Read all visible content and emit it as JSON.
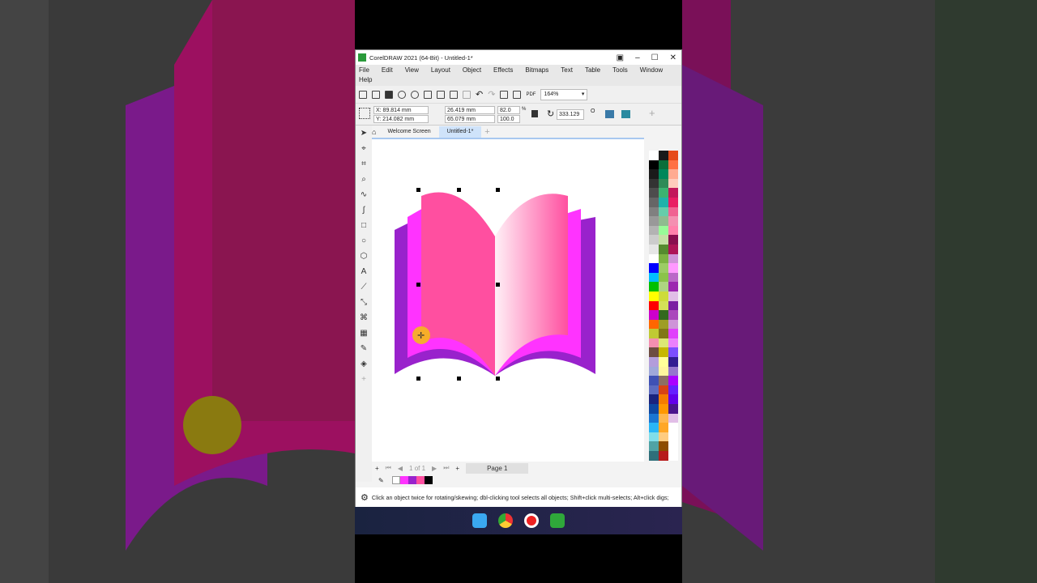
{
  "window": {
    "title": "CorelDRAW 2021 (64-Bit) - Untitled-1*"
  },
  "menu": [
    "File",
    "Edit",
    "View",
    "Layout",
    "Object",
    "Effects",
    "Bitmaps",
    "Text",
    "Table",
    "Tools",
    "Window",
    "Help"
  ],
  "toolbar": {
    "zoom": "164%"
  },
  "props": {
    "x": "X: 89.814 mm",
    "y": "Y: 214.082 mm",
    "w": "26.419 mm",
    "h": "65.079 mm",
    "sx": "82.0",
    "sy": "100.0",
    "pct": "%",
    "angle": "333.129",
    "deg": "O"
  },
  "tabs": [
    "Welcome Screen",
    "Untitled-1*"
  ],
  "pages": {
    "count": "1 of 1",
    "tab": "Page 1"
  },
  "doc_colors": [
    "#ff33ff",
    "#9922cc",
    "#ff4fa0",
    "#000000"
  ],
  "status": "Click an object twice for rotating/skewing; dbl-clicking tool selects all objects; Shift+click multi-selects; Alt+click digs;",
  "palette": [
    "#ffffff",
    "#1a1a1a",
    "#e64a19",
    "#000000",
    "#0b6e3a",
    "#ff7043",
    "#1a1a1a",
    "#00875a",
    "#ffab91",
    "#333333",
    "#2e8b57",
    "#ffccbc",
    "#4d4d4d",
    "#3cb371",
    "#c2185b",
    "#666666",
    "#20b2aa",
    "#e91e63",
    "#808080",
    "#66cdaa",
    "#f06292",
    "#999999",
    "#8fbc8f",
    "#f48fb1",
    "#b3b3b3",
    "#98fb98",
    "#ff80ab",
    "#cccccc",
    "#c5e1a5",
    "#880e4f",
    "#e6e6e6",
    "#558b2f",
    "#ad1457",
    "#ffffff",
    "#7cb342",
    "#ce93d8",
    "#0000ff",
    "#9ccc65",
    "#ff99ff",
    "#00bfff",
    "#8bc34a",
    "#ba68c8",
    "#00c000",
    "#aed581",
    "#9c27b0",
    "#ffff00",
    "#cddc39",
    "#e1bee7",
    "#ff0000",
    "#d4e157",
    "#7b1fa2",
    "#cc00cc",
    "#33691e",
    "#ab47bc",
    "#ff6600",
    "#9e9d24",
    "#ce93d8",
    "#c0ca33",
    "#827717",
    "#e040fb",
    "#f48fb1",
    "#dce775",
    "#ea80fc",
    "#6d4c41",
    "#c6b700",
    "#7c4dff",
    "#b39ddb",
    "#ffff99",
    "#311b92",
    "#9fa8da",
    "#fff59d",
    "#9575cd",
    "#3f51b5",
    "#8d6e63",
    "#aa00ff",
    "#5c6bc0",
    "#d84315",
    "#651fff",
    "#1a237e",
    "#f57c00",
    "#6200ea",
    "#0d47a1",
    "#ff9800",
    "#4a148c",
    "#1976d2",
    "#ffb74d",
    "#e1bee7",
    "#29b6f6",
    "#ffa726",
    "#fff",
    "#80deea",
    "#ffcc80",
    "#fff",
    "#4fa3a5",
    "#8d4d00",
    "#fff",
    "#2f6f7a",
    "#b71c1c",
    "#fff"
  ]
}
